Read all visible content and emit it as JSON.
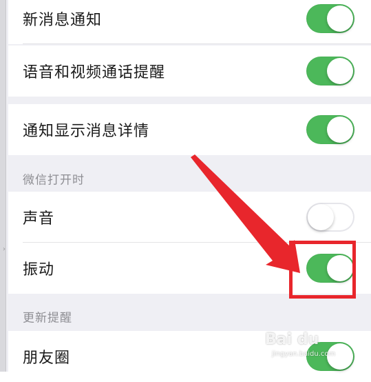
{
  "settings": {
    "rows_top": [
      {
        "label": "新消息通知",
        "toggle": true
      },
      {
        "label": "语音和视频通话提醒",
        "toggle": true
      }
    ],
    "row_details": {
      "label": "通知显示消息详情",
      "toggle": true
    },
    "section_wechat_open": {
      "header": "微信打开时",
      "rows": [
        {
          "label": "声音",
          "toggle": false
        },
        {
          "label": "振动",
          "toggle": true
        }
      ]
    },
    "section_update": {
      "header": "更新提醒",
      "rows": [
        {
          "label": "朋友圈",
          "toggle": true
        }
      ]
    }
  },
  "colors": {
    "toggle_on": "#4cb85a",
    "toggle_off": "#ffffff",
    "annotation_red": "#e8262c",
    "background": "#efeff4"
  },
  "watermark": {
    "brand": "Bai du",
    "sub": "jingyan.baidu.com"
  }
}
